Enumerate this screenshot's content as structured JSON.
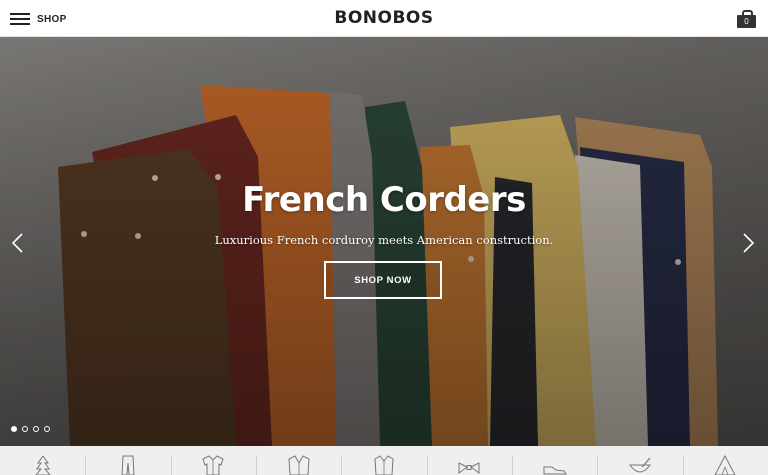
{
  "header": {
    "menu_label": "SHOP",
    "logo_text": "BONOBOS",
    "cart_count": "0"
  },
  "hero": {
    "title": "French Corders",
    "subtitle": "Luxurious French corduroy meets American construction.",
    "cta_label": "SHOP NOW",
    "slide_count": 4,
    "active_slide": 1
  },
  "categories": [
    {
      "icon": "tree-icon"
    },
    {
      "icon": "pants-icon"
    },
    {
      "icon": "shirt-icon"
    },
    {
      "icon": "suit-jacket-icon"
    },
    {
      "icon": "blazer-icon"
    },
    {
      "icon": "bow-tie-icon"
    },
    {
      "icon": "shoe-icon"
    },
    {
      "icon": "grooming-icon"
    },
    {
      "icon": "tent-icon"
    }
  ],
  "colors": {
    "header_bg": "#ffffff",
    "text": "#222222",
    "hero_bg": "#6f6c69",
    "category_bar_bg": "#efefef"
  }
}
